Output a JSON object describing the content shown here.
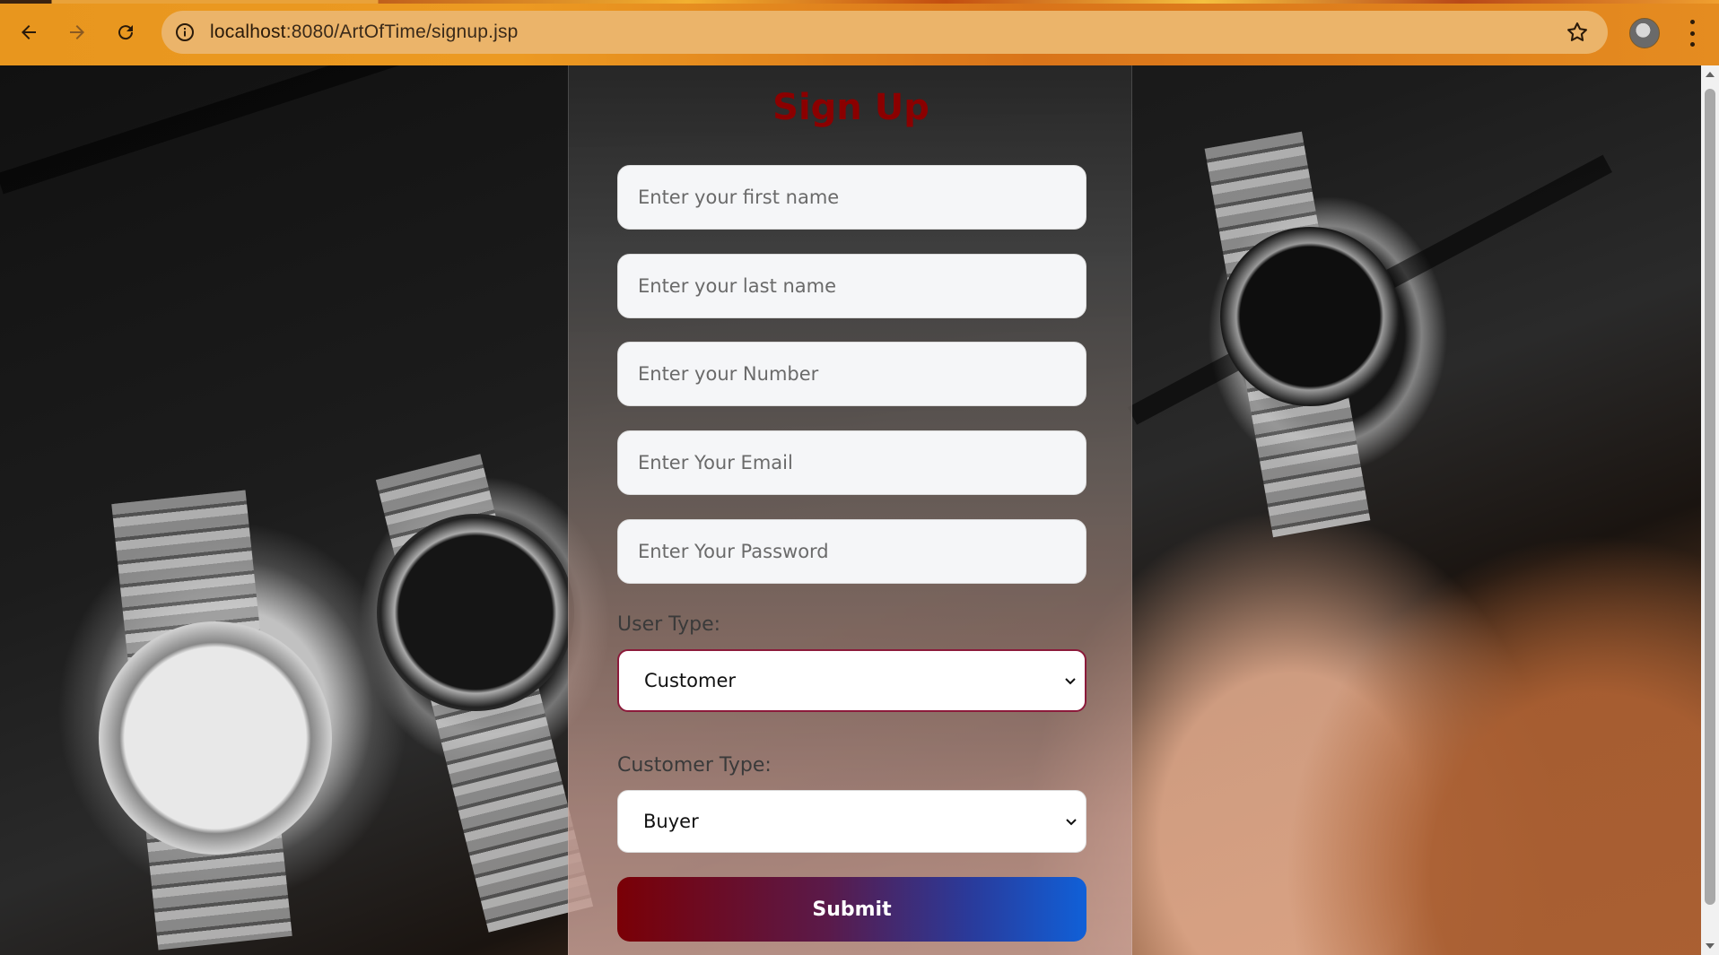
{
  "browser": {
    "url_host": "localhost",
    "url_rest": ":8080/ArtOfTime/signup.jsp",
    "icons": {
      "back": "back-arrow-icon",
      "forward": "forward-arrow-icon",
      "reload": "reload-icon",
      "site_info": "info-icon",
      "bookmark": "star-icon",
      "profile": "avatar",
      "menu": "kebab-menu-icon"
    }
  },
  "form": {
    "title": "Sign Up",
    "first_name_placeholder": "Enter your first name",
    "last_name_placeholder": "Enter your last name",
    "number_placeholder": "Enter your Number",
    "email_placeholder": "Enter Your Email",
    "password_placeholder": "Enter Your Password",
    "user_type_label": "User Type:",
    "user_type_value": "Customer",
    "customer_type_label": "Customer Type:",
    "customer_type_value": "Buyer",
    "submit_label": "Submit"
  },
  "colors": {
    "browser_bar": "#e8961e",
    "title": "#8b0000",
    "submit_gradient_start": "#7a0006",
    "submit_gradient_end": "#1060d8",
    "select_focus_border": "#8b1a3a"
  }
}
